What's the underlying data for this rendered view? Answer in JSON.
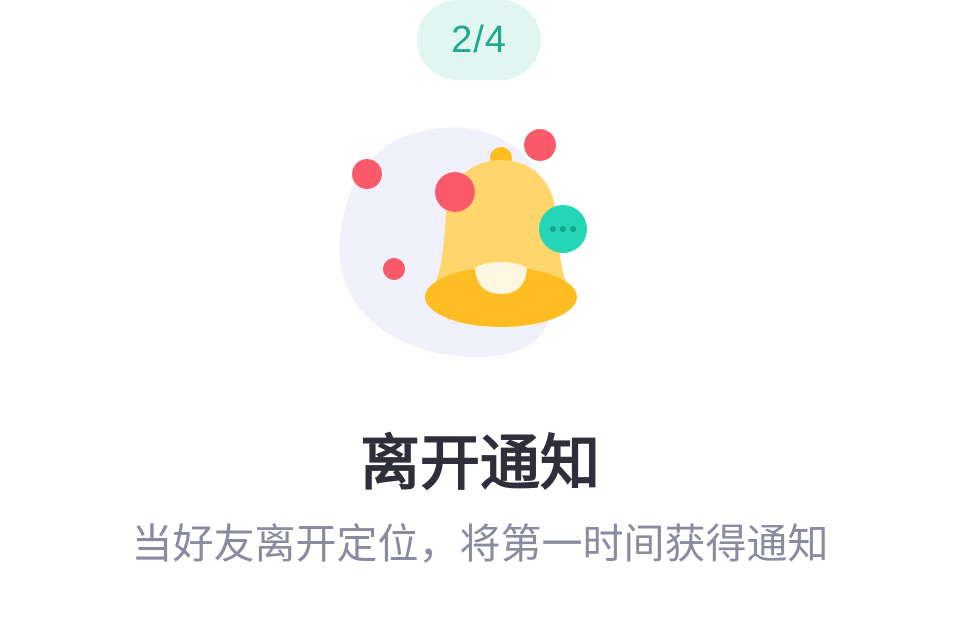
{
  "step": {
    "label": "2/4",
    "current": 2,
    "total": 4
  },
  "illustration": {
    "icon": "bell-icon",
    "badge_icon": "chat-bubble-icon",
    "colors": {
      "blob": "#f1f0fd",
      "bell": "#ffd66b",
      "bell_rim": "#ffbd24",
      "dots": "#fb5a6a",
      "bubble": "#24d6b6"
    }
  },
  "content": {
    "title": "离开通知",
    "description": "当好友离开定位，将第一时间获得通知"
  },
  "colors": {
    "accent": "#1fa98c",
    "badge_bg": "#e2f6f1",
    "title": "#2f2f3b",
    "description": "#8a8aa0"
  }
}
